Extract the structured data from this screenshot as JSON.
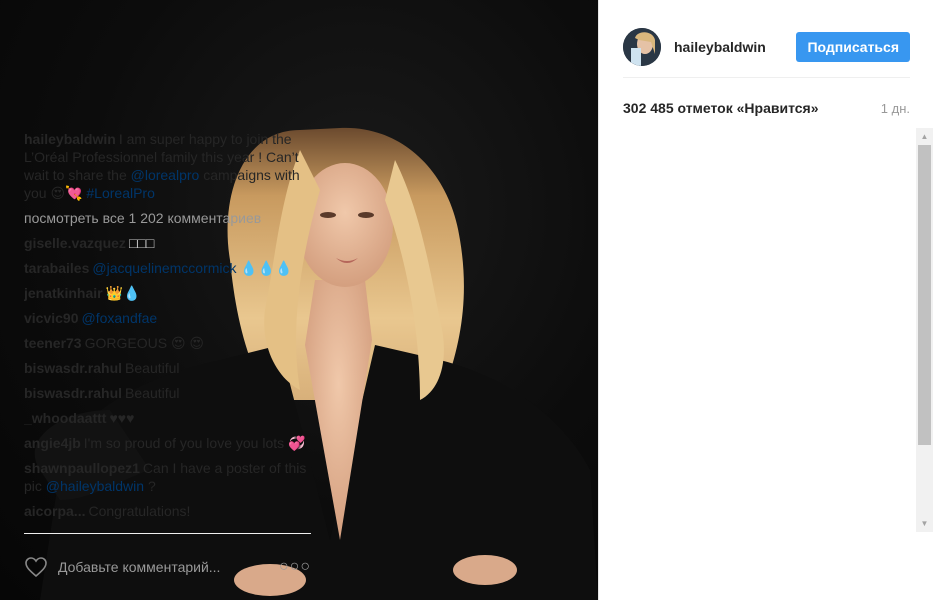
{
  "post": {
    "photo_alt": "hailey baldwin photo",
    "author": "haileybaldwin",
    "follow_label": "Подписаться",
    "likes": "302 485 отметок «Нравится»",
    "time": "1 дн."
  },
  "caption": {
    "user": "haileybaldwin",
    "text_1": "I am super happy to join the L’Oréal Professionnel family this year ! Can’t wait to share the ",
    "mention": "@lorealpro",
    "text_2": " campaigns with you 😍💘 ",
    "hashtag": "#LorealPro"
  },
  "view_all": "посмотреть все 1 202 комментариев",
  "comments": [
    {
      "user": "giselle.vazquez",
      "pre": "",
      "link": "",
      "post": "□□□"
    },
    {
      "user": "tarabailes",
      "pre": "",
      "link": "@jacquelinemccormick",
      "post": " 💧💧💧"
    },
    {
      "user": "jenatkinhair",
      "pre": "",
      "link": "",
      "post": "👑💧"
    },
    {
      "user": "vicvic90",
      "pre": "",
      "link": "@foxandfae",
      "post": ""
    },
    {
      "user": "teener73",
      "pre": "GORGEOUS 😍 😍",
      "link": "",
      "post": ""
    },
    {
      "user": "biswasdr.rahul",
      "pre": "Beautiful",
      "link": "",
      "post": ""
    },
    {
      "user": "biswasdr.rahul",
      "pre": "Beautiful",
      "link": "",
      "post": ""
    },
    {
      "user": "_whoodaattt",
      "pre": "♥♥♥",
      "link": "",
      "post": ""
    },
    {
      "user": "angie4jb",
      "pre": "I'm so proud of you love you lots 💞",
      "link": "",
      "post": ""
    },
    {
      "user": "shawnpaullopez1",
      "pre": "Can I have a poster of this pic ",
      "link": "@haileybaldwin",
      "post": " ?"
    },
    {
      "user": "aicorpa...",
      "pre": "Congratulations!",
      "link": "",
      "post": ""
    }
  ],
  "footer": {
    "placeholder": "Добавьте комментарий...",
    "more_label": "○○○"
  },
  "icons": {
    "heart": "heart-outline-icon",
    "more": "more-options-icon"
  },
  "colors": {
    "follow": "#3897f0",
    "link": "#003569",
    "muted": "#999999"
  }
}
